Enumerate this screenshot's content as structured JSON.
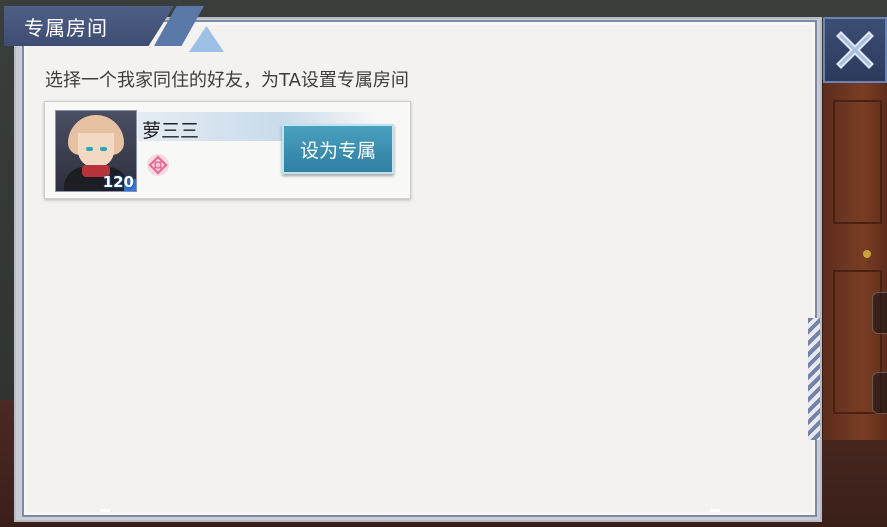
{
  "dialog": {
    "title": "专属房间",
    "instruction": "选择一个我家同住的好友，为TA设置专属房间"
  },
  "friends": [
    {
      "name": "萝三三",
      "level": "120",
      "action_label": "设为专属",
      "intimacy_icon": "heart-knot-icon"
    }
  ],
  "colors": {
    "title_bg": "#44567e",
    "button_bg": "#3b8db0",
    "panel_bg": "#f4f3f1",
    "intimacy_icon": "#e96a93"
  }
}
